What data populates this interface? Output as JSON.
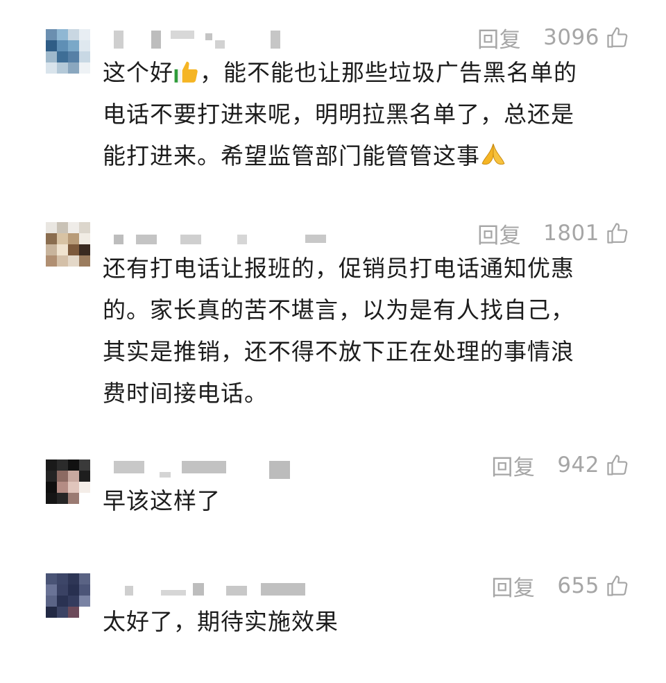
{
  "comments": [
    {
      "reply_label": "回复",
      "likes": "3096",
      "avatar_icon": "pixelated-avatar",
      "lines": [
        {
          "before": "这个好",
          "emoji": "thumbs-up-emoji",
          "after": "，能不能也让那些垃圾广告黑名单的"
        },
        {
          "text": "电话不要打进来呢，明明拉黑名单了，总还是"
        },
        {
          "before": "能打进来。希望监管部门能管管这事",
          "emoji": "praying-hands-emoji",
          "after": ""
        }
      ]
    },
    {
      "reply_label": "回复",
      "likes": "1801",
      "avatar_icon": "pixelated-avatar",
      "lines": [
        {
          "text": "还有打电话让报班的，促销员打电话通知优惠"
        },
        {
          "text": "的。家长真的苦不堪言，以为是有人找自己，"
        },
        {
          "text": "其实是推销，还不得不放下正在处理的事情浪"
        },
        {
          "text": "费时间接电话。"
        }
      ]
    },
    {
      "reply_label": "回复",
      "likes": "942",
      "avatar_icon": "pixelated-avatar",
      "lines": [
        {
          "text": "早该这样了"
        }
      ]
    },
    {
      "reply_label": "回复",
      "likes": "655",
      "avatar_icon": "pixelated-avatar",
      "lines": [
        {
          "text": "太好了，期待实施效果"
        }
      ]
    }
  ],
  "icons": {
    "like": "thumbs-up-outline-icon"
  },
  "colors": {
    "meta_gray": "#a6a6a6",
    "text": "#1c1c1c",
    "background": "#ffffff"
  }
}
